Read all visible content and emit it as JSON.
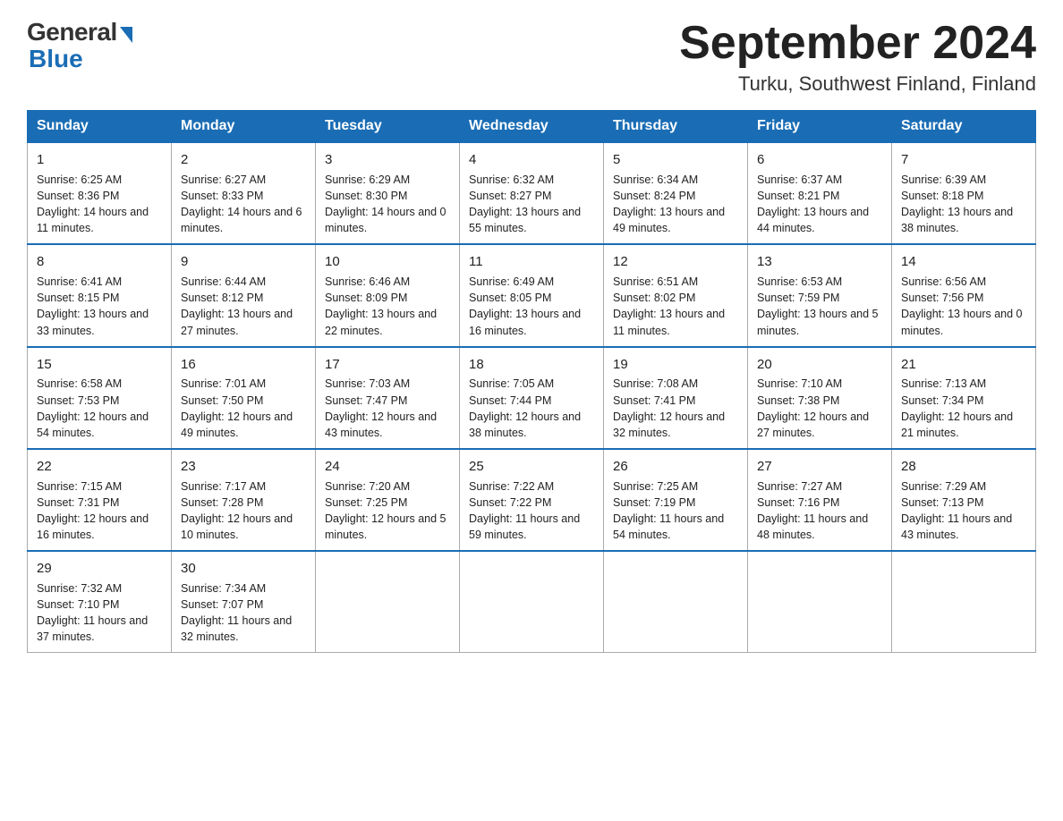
{
  "header": {
    "logo_general": "General",
    "logo_blue": "Blue",
    "month_title": "September 2024",
    "location": "Turku, Southwest Finland, Finland"
  },
  "days_of_week": [
    "Sunday",
    "Monday",
    "Tuesday",
    "Wednesday",
    "Thursday",
    "Friday",
    "Saturday"
  ],
  "weeks": [
    [
      {
        "day": "1",
        "sunrise": "6:25 AM",
        "sunset": "8:36 PM",
        "daylight": "14 hours and 11 minutes."
      },
      {
        "day": "2",
        "sunrise": "6:27 AM",
        "sunset": "8:33 PM",
        "daylight": "14 hours and 6 minutes."
      },
      {
        "day": "3",
        "sunrise": "6:29 AM",
        "sunset": "8:30 PM",
        "daylight": "14 hours and 0 minutes."
      },
      {
        "day": "4",
        "sunrise": "6:32 AM",
        "sunset": "8:27 PM",
        "daylight": "13 hours and 55 minutes."
      },
      {
        "day": "5",
        "sunrise": "6:34 AM",
        "sunset": "8:24 PM",
        "daylight": "13 hours and 49 minutes."
      },
      {
        "day": "6",
        "sunrise": "6:37 AM",
        "sunset": "8:21 PM",
        "daylight": "13 hours and 44 minutes."
      },
      {
        "day": "7",
        "sunrise": "6:39 AM",
        "sunset": "8:18 PM",
        "daylight": "13 hours and 38 minutes."
      }
    ],
    [
      {
        "day": "8",
        "sunrise": "6:41 AM",
        "sunset": "8:15 PM",
        "daylight": "13 hours and 33 minutes."
      },
      {
        "day": "9",
        "sunrise": "6:44 AM",
        "sunset": "8:12 PM",
        "daylight": "13 hours and 27 minutes."
      },
      {
        "day": "10",
        "sunrise": "6:46 AM",
        "sunset": "8:09 PM",
        "daylight": "13 hours and 22 minutes."
      },
      {
        "day": "11",
        "sunrise": "6:49 AM",
        "sunset": "8:05 PM",
        "daylight": "13 hours and 16 minutes."
      },
      {
        "day": "12",
        "sunrise": "6:51 AM",
        "sunset": "8:02 PM",
        "daylight": "13 hours and 11 minutes."
      },
      {
        "day": "13",
        "sunrise": "6:53 AM",
        "sunset": "7:59 PM",
        "daylight": "13 hours and 5 minutes."
      },
      {
        "day": "14",
        "sunrise": "6:56 AM",
        "sunset": "7:56 PM",
        "daylight": "13 hours and 0 minutes."
      }
    ],
    [
      {
        "day": "15",
        "sunrise": "6:58 AM",
        "sunset": "7:53 PM",
        "daylight": "12 hours and 54 minutes."
      },
      {
        "day": "16",
        "sunrise": "7:01 AM",
        "sunset": "7:50 PM",
        "daylight": "12 hours and 49 minutes."
      },
      {
        "day": "17",
        "sunrise": "7:03 AM",
        "sunset": "7:47 PM",
        "daylight": "12 hours and 43 minutes."
      },
      {
        "day": "18",
        "sunrise": "7:05 AM",
        "sunset": "7:44 PM",
        "daylight": "12 hours and 38 minutes."
      },
      {
        "day": "19",
        "sunrise": "7:08 AM",
        "sunset": "7:41 PM",
        "daylight": "12 hours and 32 minutes."
      },
      {
        "day": "20",
        "sunrise": "7:10 AM",
        "sunset": "7:38 PM",
        "daylight": "12 hours and 27 minutes."
      },
      {
        "day": "21",
        "sunrise": "7:13 AM",
        "sunset": "7:34 PM",
        "daylight": "12 hours and 21 minutes."
      }
    ],
    [
      {
        "day": "22",
        "sunrise": "7:15 AM",
        "sunset": "7:31 PM",
        "daylight": "12 hours and 16 minutes."
      },
      {
        "day": "23",
        "sunrise": "7:17 AM",
        "sunset": "7:28 PM",
        "daylight": "12 hours and 10 minutes."
      },
      {
        "day": "24",
        "sunrise": "7:20 AM",
        "sunset": "7:25 PM",
        "daylight": "12 hours and 5 minutes."
      },
      {
        "day": "25",
        "sunrise": "7:22 AM",
        "sunset": "7:22 PM",
        "daylight": "11 hours and 59 minutes."
      },
      {
        "day": "26",
        "sunrise": "7:25 AM",
        "sunset": "7:19 PM",
        "daylight": "11 hours and 54 minutes."
      },
      {
        "day": "27",
        "sunrise": "7:27 AM",
        "sunset": "7:16 PM",
        "daylight": "11 hours and 48 minutes."
      },
      {
        "day": "28",
        "sunrise": "7:29 AM",
        "sunset": "7:13 PM",
        "daylight": "11 hours and 43 minutes."
      }
    ],
    [
      {
        "day": "29",
        "sunrise": "7:32 AM",
        "sunset": "7:10 PM",
        "daylight": "11 hours and 37 minutes."
      },
      {
        "day": "30",
        "sunrise": "7:34 AM",
        "sunset": "7:07 PM",
        "daylight": "11 hours and 32 minutes."
      },
      null,
      null,
      null,
      null,
      null
    ]
  ]
}
